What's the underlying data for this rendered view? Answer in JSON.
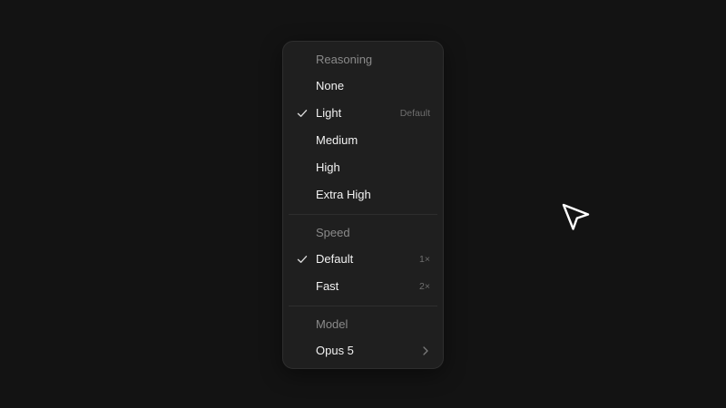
{
  "menu": {
    "reasoning": {
      "label": "Reasoning",
      "items": [
        {
          "label": "None",
          "hint": "",
          "checked": false
        },
        {
          "label": "Light",
          "hint": "Default",
          "checked": true
        },
        {
          "label": "Medium",
          "hint": "",
          "checked": false
        },
        {
          "label": "High",
          "hint": "",
          "checked": false
        },
        {
          "label": "Extra High",
          "hint": "",
          "checked": false
        }
      ]
    },
    "speed": {
      "label": "Speed",
      "items": [
        {
          "label": "Default",
          "hint": "1×",
          "checked": true
        },
        {
          "label": "Fast",
          "hint": "2×",
          "checked": false
        }
      ]
    },
    "model": {
      "label": "Model",
      "items": [
        {
          "label": "Opus 5",
          "submenu": true,
          "icon": "chevron-right-icon"
        }
      ]
    }
  },
  "icons": {
    "check": "check-icon",
    "cursor": "arrow-cursor-icon"
  },
  "colors": {
    "background": "#131313",
    "menu_bg": "#1f1f1f",
    "menu_border": "#2e2e2e",
    "text_primary": "#f2f2f2",
    "text_section": "#8a8a8a",
    "text_hint": "#6e6e6e"
  }
}
